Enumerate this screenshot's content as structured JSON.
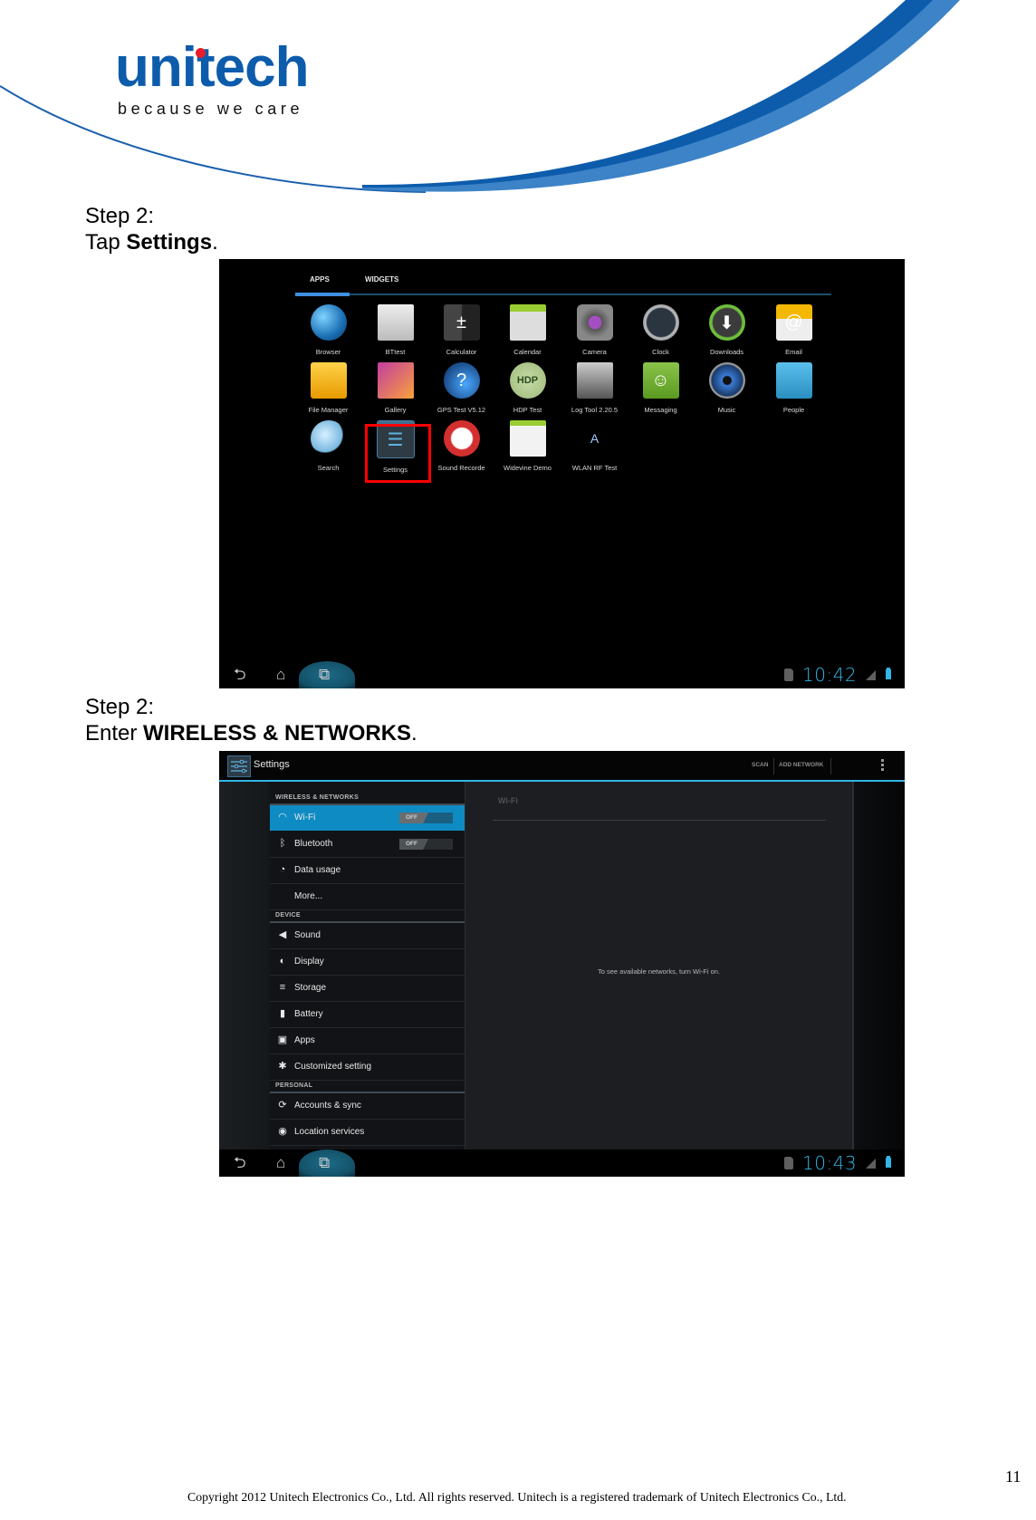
{
  "header": {
    "logo_text": "unitech",
    "tagline": "because we care",
    "brand_color": "#0d5cac",
    "accent_dot_color": "#e61e2a"
  },
  "steps": [
    {
      "label": "Step 2:",
      "prefix": "Tap ",
      "bold": "Settings",
      "suffix": "."
    },
    {
      "label": "Step 2:",
      "prefix": "Enter ",
      "bold": "WIRELESS & NETWORKS",
      "suffix": "."
    }
  ],
  "screenshot1": {
    "tabs": [
      "APPS",
      "WIDGETS"
    ],
    "selected_tab": "APPS",
    "apps": [
      {
        "label": "Browser",
        "icon": "globe-icon"
      },
      {
        "label": "BTtest",
        "icon": "document-icon"
      },
      {
        "label": "Calculator",
        "icon": "calculator-icon"
      },
      {
        "label": "Calendar",
        "icon": "calendar-icon"
      },
      {
        "label": "Camera",
        "icon": "camera-icon"
      },
      {
        "label": "Clock",
        "icon": "clock-icon"
      },
      {
        "label": "Downloads",
        "icon": "download-icon"
      },
      {
        "label": "Email",
        "icon": "email-icon"
      },
      {
        "label": "File Manager",
        "icon": "folder-icon"
      },
      {
        "label": "Gallery",
        "icon": "gallery-icon"
      },
      {
        "label": "GPS Test V5.12",
        "icon": "gps-icon"
      },
      {
        "label": "HDP Test",
        "icon": "hdp-icon"
      },
      {
        "label": "Log Tool 2.20.5",
        "icon": "log-tool-icon"
      },
      {
        "label": "Messaging",
        "icon": "messaging-icon"
      },
      {
        "label": "Music",
        "icon": "speaker-icon"
      },
      {
        "label": "People",
        "icon": "contact-icon"
      },
      {
        "label": "Search",
        "icon": "magnifier-icon"
      },
      {
        "label": "Settings",
        "icon": "settings-sliders-icon",
        "highlighted": true
      },
      {
        "label": "Sound Recorde",
        "icon": "microphone-icon"
      },
      {
        "label": "Widevine Demo",
        "icon": "android-icon"
      },
      {
        "label": "WLAN RF Test",
        "icon": "antenna-icon"
      }
    ],
    "status": {
      "time": "10:42"
    }
  },
  "screenshot2": {
    "title": "Settings",
    "actions": [
      "SCAN",
      "ADD NETWORK"
    ],
    "sections": [
      {
        "header": "WIRELESS & NETWORKS",
        "items": [
          {
            "label": "Wi-Fi",
            "icon": "wifi-icon",
            "toggle": "OFF",
            "active": true
          },
          {
            "label": "Bluetooth",
            "icon": "bluetooth-icon",
            "toggle": "OFF"
          },
          {
            "label": "Data usage",
            "icon": "data-usage-icon"
          },
          {
            "label": "More...",
            "icon": ""
          }
        ]
      },
      {
        "header": "DEVICE",
        "items": [
          {
            "label": "Sound",
            "icon": "speaker-icon"
          },
          {
            "label": "Display",
            "icon": "brightness-icon"
          },
          {
            "label": "Storage",
            "icon": "storage-icon"
          },
          {
            "label": "Battery",
            "icon": "battery-icon"
          },
          {
            "label": "Apps",
            "icon": "apps-icon"
          },
          {
            "label": "Customized setting",
            "icon": "gear-icon"
          }
        ]
      },
      {
        "header": "PERSONAL",
        "items": [
          {
            "label": "Accounts & sync",
            "icon": "sync-icon"
          },
          {
            "label": "Location services",
            "icon": "location-icon"
          }
        ]
      }
    ],
    "detail": {
      "title": "Wi-Fi",
      "message": "To see available networks, turn Wi-Fi on."
    },
    "status": {
      "time": "10:43"
    }
  },
  "footer": {
    "page_number": "11",
    "copyright": "Copyright 2012 Unitech Electronics Co., Ltd. All rights reserved. Unitech is a registered trademark of Unitech Electronics Co., Ltd."
  }
}
